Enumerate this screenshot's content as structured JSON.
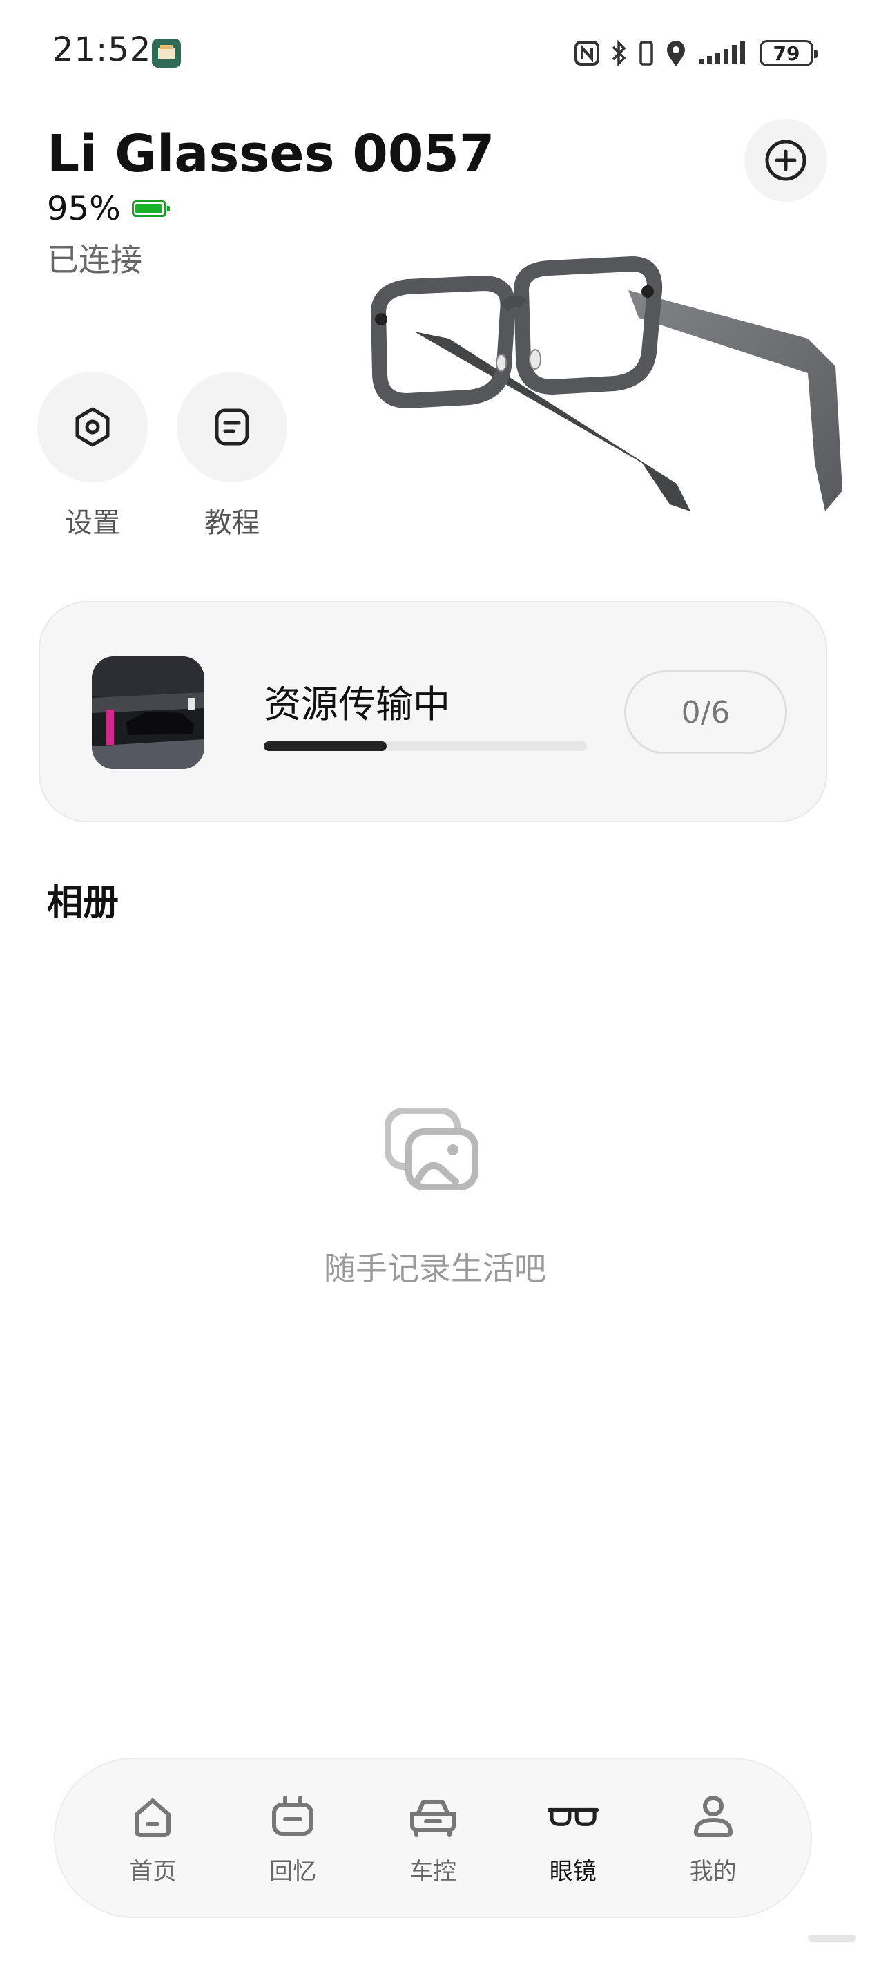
{
  "status_bar": {
    "time": "21:52",
    "battery": "79",
    "icons": [
      "nfc-icon",
      "bluetooth-icon",
      "vibrate-icon",
      "location-icon",
      "signal-icon",
      "battery-icon"
    ]
  },
  "device": {
    "name": "Li Glasses 0057",
    "battery": "95%",
    "battery_level": 0.95,
    "status": "已连接"
  },
  "quick_actions": [
    {
      "label": "设置",
      "icon": "gear-icon"
    },
    {
      "label": "教程",
      "icon": "guide-icon"
    }
  ],
  "transfer": {
    "title": "资源传输中",
    "progress": 0.38,
    "count": "0/6"
  },
  "album": {
    "title": "相册",
    "empty_text": "随手记录生活吧"
  },
  "nav": [
    {
      "label": "首页",
      "icon": "home-icon",
      "active": false
    },
    {
      "label": "回忆",
      "icon": "memory-icon",
      "active": false
    },
    {
      "label": "车控",
      "icon": "car-icon",
      "active": false
    },
    {
      "label": "眼镜",
      "icon": "glasses-icon",
      "active": true
    },
    {
      "label": "我的",
      "icon": "profile-icon",
      "active": false
    }
  ],
  "colors": {
    "battery_green": "#1ab22a",
    "progress": "#222222",
    "card_bg": "#f6f6f6"
  }
}
